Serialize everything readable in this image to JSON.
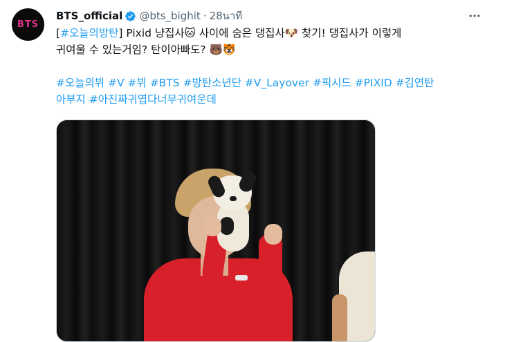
{
  "tweet": {
    "avatar_text": "BTS",
    "display_name": "BTS_official",
    "handle": "@bts_bighit",
    "separator": "·",
    "time": "28นาที",
    "line1": {
      "bracket_open": "[",
      "tag": "#오늘의방탄",
      "text1": "] Pixid 냥집사",
      "emoji1": "🐱",
      "text2": " 사이에 숨은 댕집사",
      "emoji2": "🐶",
      "text3": " 찾기! 댕집사가 이렇게"
    },
    "line2": {
      "text": "귀여울 수 있는거임? 탄이아빠도? ",
      "emoji1": "🐻",
      "emoji2": "🐯"
    },
    "hashtags_line1": [
      "#오늘의뷔",
      "#V",
      "#뷔",
      "#BTS",
      "#방탄소년단",
      "#V_Layover",
      "#픽시드",
      "#PIXID",
      "#김연탄"
    ],
    "hashtags_line2": [
      "아부지",
      "#아진짜귀엽다너무귀여운데"
    ]
  },
  "colors": {
    "link": "#1d9bf0",
    "text": "#0f1419",
    "secondary": "#536471",
    "verified": "#1d9bf0",
    "avatar_bg": "#0b0b0b",
    "avatar_text": "#e0328c"
  },
  "icons": {
    "verified": "verified-badge-icon",
    "more": "more-options-icon"
  }
}
